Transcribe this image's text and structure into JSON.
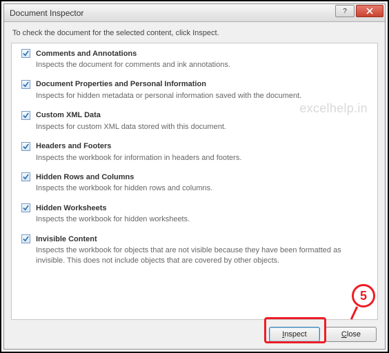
{
  "window": {
    "title": "Document Inspector"
  },
  "instruction": "To check the document for the selected content, click Inspect.",
  "watermark": "excelhelp.in",
  "items": [
    {
      "title": "Comments and Annotations",
      "desc": "Inspects the document for comments and ink annotations.",
      "checked": true
    },
    {
      "title": "Document Properties and Personal Information",
      "desc": "Inspects for hidden metadata or personal information saved with the document.",
      "checked": true
    },
    {
      "title": "Custom XML Data",
      "desc": "Inspects for custom XML data stored with this document.",
      "checked": true
    },
    {
      "title": "Headers and Footers",
      "desc": "Inspects the workbook for information in headers and footers.",
      "checked": true
    },
    {
      "title": "Hidden Rows and Columns",
      "desc": "Inspects the workbook for hidden rows and columns.",
      "checked": true
    },
    {
      "title": "Hidden Worksheets",
      "desc": "Inspects the workbook for hidden worksheets.",
      "checked": true
    },
    {
      "title": "Invisible Content",
      "desc": "Inspects the workbook for objects that are not visible because they have been formatted as invisible. This does not include objects that are covered by other objects.",
      "checked": true
    }
  ],
  "buttons": {
    "inspect": "Inspect",
    "close": "Close"
  },
  "callout": {
    "number": "5"
  }
}
